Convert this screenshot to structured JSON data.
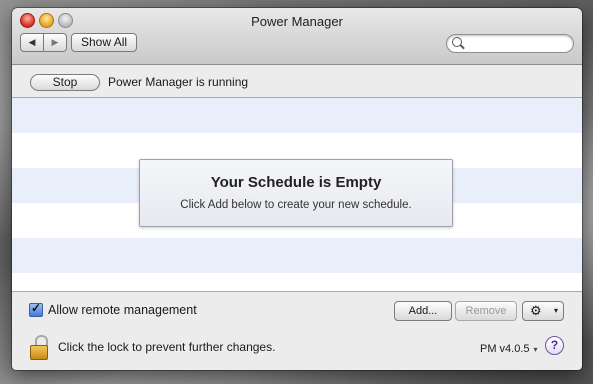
{
  "window": {
    "title": "Power Manager"
  },
  "toolbar": {
    "back_glyph": "◀",
    "forward_glyph": "▶",
    "show_all_label": "Show All",
    "search_placeholder": ""
  },
  "status": {
    "stop_label": "Stop",
    "message": "Power Manager is running"
  },
  "schedule": {
    "empty_title": "Your Schedule is Empty",
    "empty_subtitle": "Click Add below to create your new schedule."
  },
  "controls": {
    "remote_management_label": "Allow remote management",
    "remote_management_checked": true,
    "add_label": "Add...",
    "remove_label": "Remove",
    "gear_glyph": "⚙",
    "dropdown_glyph": "▾",
    "lock_message": "Click the lock to prevent further changes.",
    "version_label": "PM v4.0.5",
    "help_glyph": "?"
  },
  "colors": {
    "accent": "#3d7ae0",
    "row_alt": "#e8eefa",
    "help": "#4a2d96",
    "lock": "#e0a62c"
  }
}
